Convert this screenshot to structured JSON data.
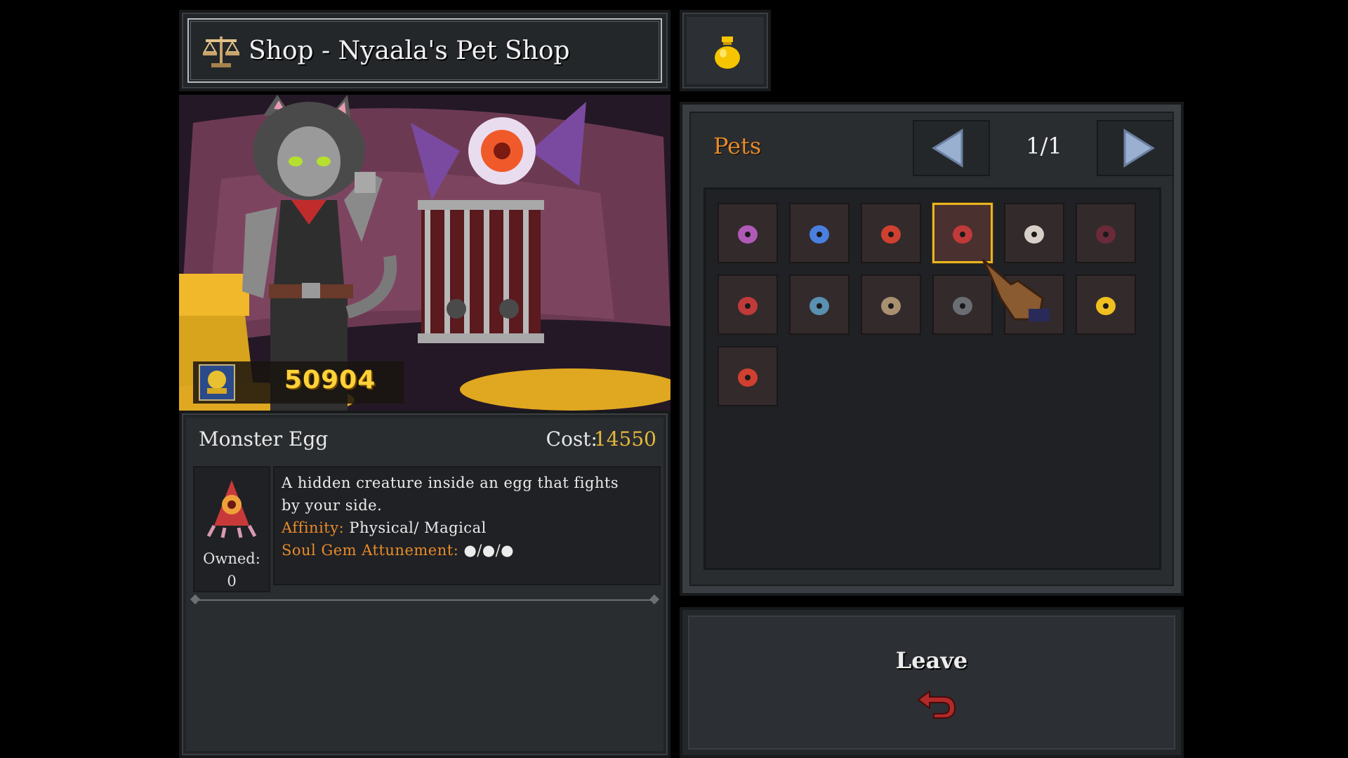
{
  "header": {
    "title": "Shop - Nyaala's Pet Shop",
    "icon": "scale-icon"
  },
  "gold_bag": {
    "icon": "gold-bag-icon"
  },
  "scene": {
    "gold": "50904"
  },
  "item": {
    "name": "Monster Egg",
    "cost_label": "Cost:",
    "cost_value": "14550",
    "owned_label": "Owned:",
    "owned_value": "0",
    "description_line1": "A hidden creature inside an egg that fights",
    "description_line2": "by your side.",
    "affinity_label": "Affinity:",
    "affinity_value": " Physical/ Magical",
    "attunement_label": "Soul Gem Attunement:",
    "attunement_value": " ●/●/●"
  },
  "pets": {
    "title": "Pets",
    "page": "1/1",
    "selected_index": 3,
    "slots": [
      {
        "icon": "purple-mushroom-pet-icon",
        "color": "#b05ab8"
      },
      {
        "icon": "blue-crystal-pet-icon",
        "color": "#4a7fe0"
      },
      {
        "icon": "red-mushroom-pet-icon",
        "color": "#d04030"
      },
      {
        "icon": "hooded-egg-monster-icon",
        "color": "#c03a3a"
      },
      {
        "icon": "white-rat-pet-icon",
        "color": "#d8d0c8"
      },
      {
        "icon": "dark-bat-pet-icon",
        "color": "#6a2a3a"
      },
      {
        "icon": "red-cap-pet-icon",
        "color": "#c03a3a"
      },
      {
        "icon": "blue-imp-pet-icon",
        "color": "#5a90b0"
      },
      {
        "icon": "bone-golem-pet-icon",
        "color": "#a89070"
      },
      {
        "icon": "stone-head-pet-icon",
        "color": "#6a6e72"
      },
      {
        "icon": "empty-slot-icon",
        "color": "#332a2b"
      },
      {
        "icon": "yellow-chick-pet-icon",
        "color": "#f0c020"
      },
      {
        "icon": "red-demon-pet-icon",
        "color": "#d04030"
      }
    ]
  },
  "leave": {
    "label": "Leave",
    "icon": "return-arrow-icon"
  }
}
